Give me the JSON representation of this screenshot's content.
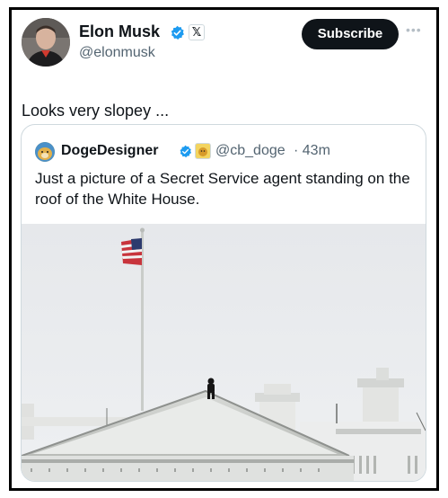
{
  "author": {
    "name": "Elon Musk",
    "handle": "@elonmusk",
    "avatar_icon": "profile-photo",
    "verified_icon": "verified-check-icon",
    "org_icon": "x-logo-icon",
    "x_glyph": "𝕏"
  },
  "actions": {
    "subscribe_label": "Subscribe",
    "more_glyph": "•••"
  },
  "post": {
    "text": "Looks very slopey ..."
  },
  "quoted": {
    "name": "DogeDesigner",
    "handle": "@cb_doge",
    "time": "· 43m",
    "text": "Just a picture of a Secret Service agent standing on the roof of the White House.",
    "image_icon": "white-house-roof-photo"
  },
  "colors": {
    "text": "#0f1419",
    "secondary": "#536471",
    "border": "#cfd9de",
    "verified": "#1d9bf0",
    "button": "#0f1419"
  }
}
